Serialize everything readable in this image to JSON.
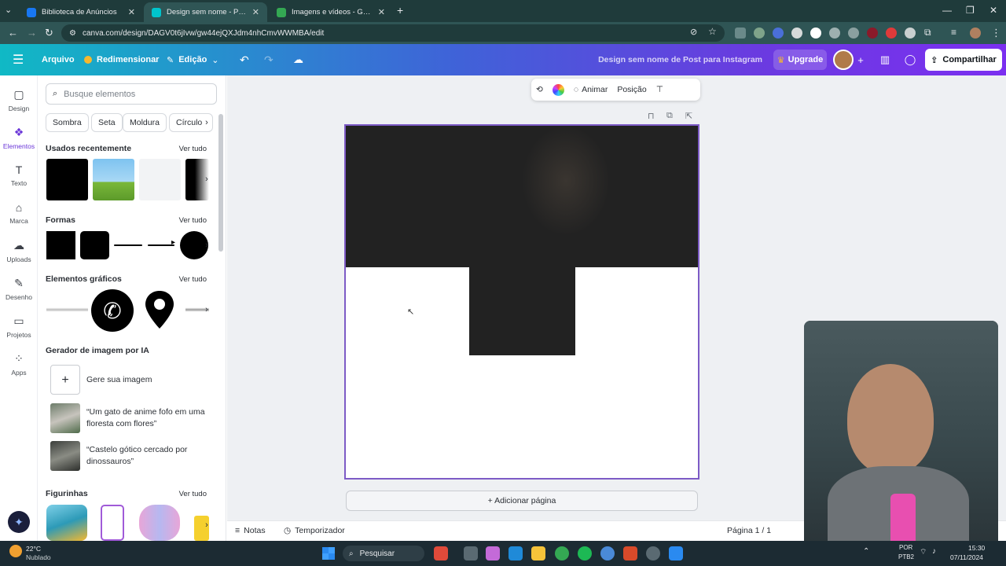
{
  "browser": {
    "tabs": [
      {
        "title": "Biblioteca de Anúncios",
        "active": false,
        "icon": "meta-icon",
        "color": "#1877f2"
      },
      {
        "title": "Design sem nome - Post para Insta",
        "active": true,
        "icon": "canva-icon",
        "color": "#00c4cc"
      },
      {
        "title": "Imagens e vídeos - Google Drive",
        "active": false,
        "icon": "drive-icon",
        "color": "#34a853"
      }
    ],
    "new_tab": "+",
    "url": "canva.com/design/DAGV0t6jIvw/gw44ejQXJdm4nhCmvWWMBA/edit"
  },
  "header": {
    "file_menu": "Arquivo",
    "resize": "Redimensionar",
    "edit": "Edição",
    "design_name": "Design sem nome de Post para Instagram",
    "upgrade": "Upgrade",
    "share": "Compartilhar"
  },
  "rail": [
    {
      "label": "Design",
      "icon": "design-icon"
    },
    {
      "label": "Elementos",
      "icon": "elements-icon",
      "active": true
    },
    {
      "label": "Texto",
      "icon": "text-icon"
    },
    {
      "label": "Marca",
      "icon": "brand-icon"
    },
    {
      "label": "Uploads",
      "icon": "uploads-icon"
    },
    {
      "label": "Desenho",
      "icon": "draw-icon"
    },
    {
      "label": "Projetos",
      "icon": "projects-icon"
    },
    {
      "label": "Apps",
      "icon": "apps-icon"
    }
  ],
  "panel": {
    "search_placeholder": "Busque elementos",
    "chips": [
      "Sombra",
      "Seta",
      "Moldura",
      "Círculo"
    ],
    "sections": {
      "recent": "Usados recentemente",
      "shapes": "Formas",
      "graphics": "Elementos gráficos",
      "ai": "Gerador de imagem por IA",
      "stickers": "Figurinhas"
    },
    "see_all": "Ver tudo",
    "ai_generate": "Gere sua imagem",
    "prompts": [
      "“Um gato de anime fofo em uma floresta com flores”",
      "“Castelo gótico cercado por dinossauros”"
    ]
  },
  "toolbar": {
    "animate": "Animar",
    "position": "Posição"
  },
  "canvas": {
    "add_page": "+ Adicionar página"
  },
  "footer": {
    "notes": "Notas",
    "timer": "Temporizador",
    "page": "Página 1 / 1"
  },
  "taskbar": {
    "weather_temp": "22°C",
    "weather_desc": "Nublado",
    "search": "Pesquisar",
    "lang": "POR",
    "layout": "PTB2",
    "time": "15:30",
    "date": "07/11/2024"
  },
  "colors": {
    "accent": "#7d5bc6",
    "canva_gradient_start": "#10b9c5",
    "canva_gradient_end": "#7b2ff0"
  }
}
